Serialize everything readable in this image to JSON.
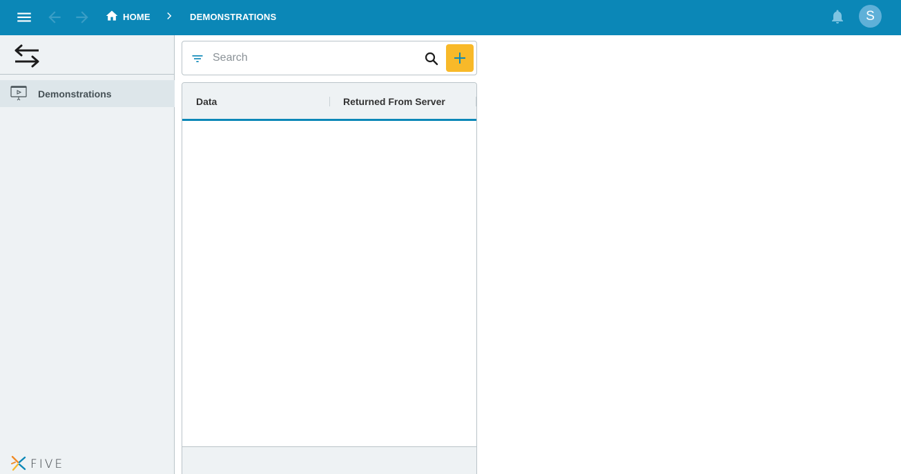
{
  "header": {
    "breadcrumb": {
      "home_label": "HOME",
      "current_label": "DEMONSTRATIONS"
    },
    "avatar_initial": "S",
    "icons": {
      "menu": "menu-icon",
      "back": "arrow-back-icon",
      "forward": "arrow-forward-icon",
      "home": "home-icon",
      "separator": "chevron-right-icon",
      "notifications": "bell-icon"
    },
    "colors": {
      "bar": "#0b87b7",
      "avatar": "#5fb0d8"
    }
  },
  "sidebar": {
    "toggle_icon": "swap-arrows-icon",
    "items": [
      {
        "label": "Demonstrations",
        "icon": "presentation-icon",
        "selected": true
      }
    ],
    "logo_text": "FIVE"
  },
  "search": {
    "placeholder": "Search",
    "value": "",
    "add_color": "#f8b929"
  },
  "table": {
    "columns": [
      "Data",
      "Returned From Server"
    ],
    "rows": []
  }
}
